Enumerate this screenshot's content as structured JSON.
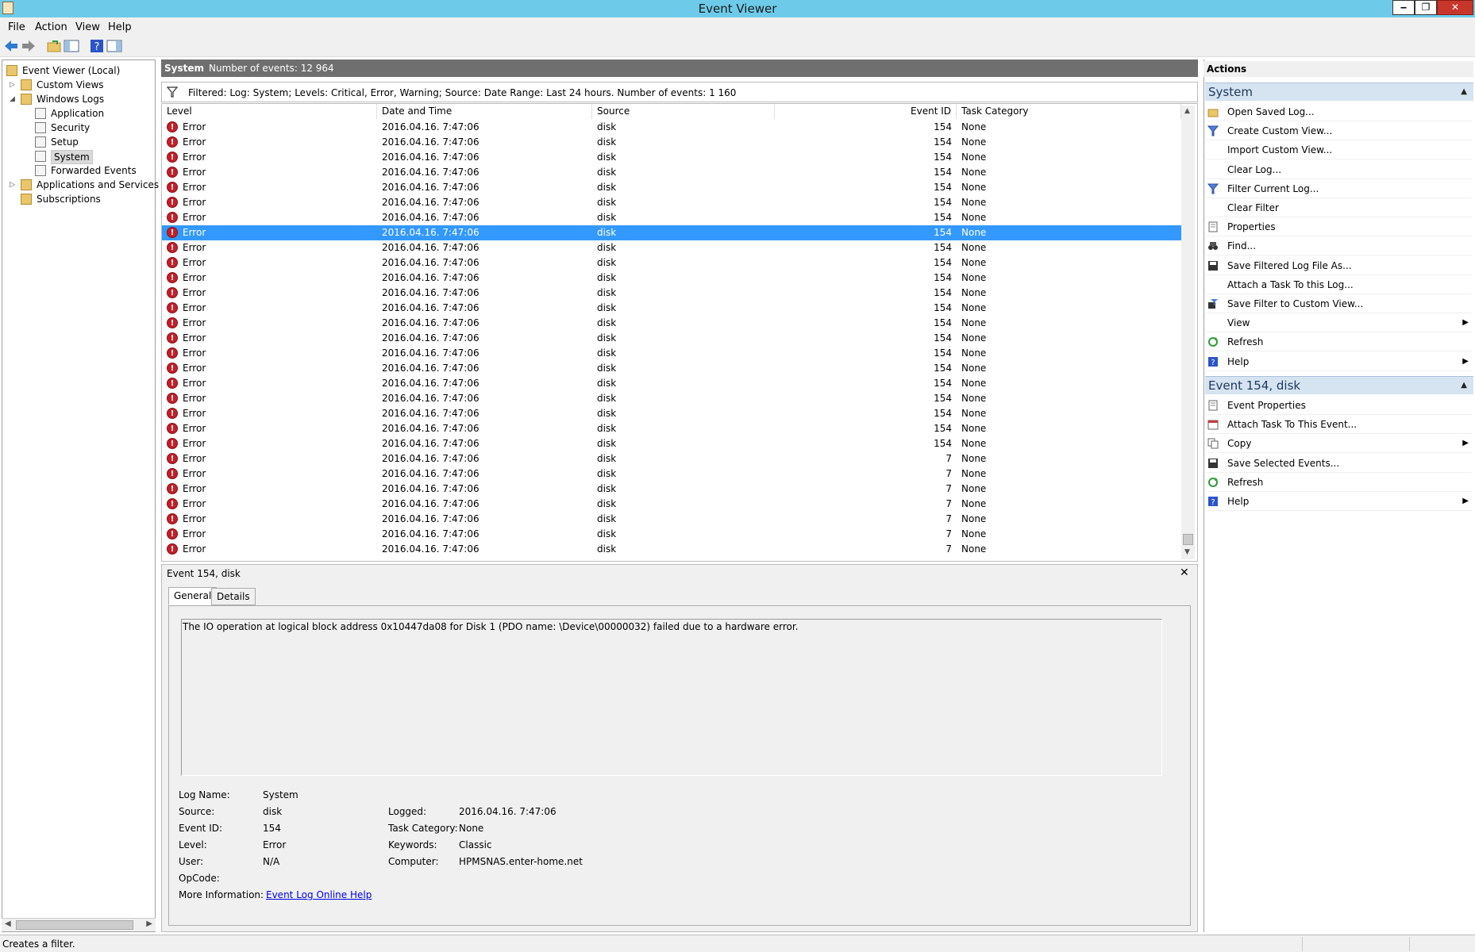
{
  "window": {
    "title": "Event Viewer",
    "min": "‒",
    "max": "❐",
    "close": "✕"
  },
  "menu": [
    "File",
    "Action",
    "View",
    "Help"
  ],
  "tree": [
    {
      "label": "Event Viewer (Local)",
      "indent": 0,
      "expander": ""
    },
    {
      "label": "Custom Views",
      "indent": 1,
      "expander": "▷"
    },
    {
      "label": "Windows Logs",
      "indent": 1,
      "expander": "◢"
    },
    {
      "label": "Application",
      "indent": 2,
      "expander": ""
    },
    {
      "label": "Security",
      "indent": 2,
      "expander": ""
    },
    {
      "label": "Setup",
      "indent": 2,
      "expander": ""
    },
    {
      "label": "System",
      "indent": 2,
      "expander": "",
      "selected": true
    },
    {
      "label": "Forwarded Events",
      "indent": 2,
      "expander": ""
    },
    {
      "label": "Applications and Services Lo",
      "indent": 1,
      "expander": "▷"
    },
    {
      "label": "Subscriptions",
      "indent": 1,
      "expander": ""
    }
  ],
  "center": {
    "log_name": "System",
    "count_text": "Number of events: 12 964",
    "filter_text": "Filtered: Log: System; Levels: Critical, Error, Warning; Source: Date Range: Last 24 hours. Number of events: 1 160",
    "columns": [
      "Level",
      "Date and Time",
      "Source",
      "Event ID",
      "Task Category"
    ],
    "rows": [
      {
        "level": "Error",
        "date": "2016.04.16. 7:47:06",
        "source": "disk",
        "id": "154",
        "task": "None"
      },
      {
        "level": "Error",
        "date": "2016.04.16. 7:47:06",
        "source": "disk",
        "id": "154",
        "task": "None"
      },
      {
        "level": "Error",
        "date": "2016.04.16. 7:47:06",
        "source": "disk",
        "id": "154",
        "task": "None"
      },
      {
        "level": "Error",
        "date": "2016.04.16. 7:47:06",
        "source": "disk",
        "id": "154",
        "task": "None"
      },
      {
        "level": "Error",
        "date": "2016.04.16. 7:47:06",
        "source": "disk",
        "id": "154",
        "task": "None"
      },
      {
        "level": "Error",
        "date": "2016.04.16. 7:47:06",
        "source": "disk",
        "id": "154",
        "task": "None"
      },
      {
        "level": "Error",
        "date": "2016.04.16. 7:47:06",
        "source": "disk",
        "id": "154",
        "task": "None"
      },
      {
        "level": "Error",
        "date": "2016.04.16. 7:47:06",
        "source": "disk",
        "id": "154",
        "task": "None",
        "selected": true
      },
      {
        "level": "Error",
        "date": "2016.04.16. 7:47:06",
        "source": "disk",
        "id": "154",
        "task": "None"
      },
      {
        "level": "Error",
        "date": "2016.04.16. 7:47:06",
        "source": "disk",
        "id": "154",
        "task": "None"
      },
      {
        "level": "Error",
        "date": "2016.04.16. 7:47:06",
        "source": "disk",
        "id": "154",
        "task": "None"
      },
      {
        "level": "Error",
        "date": "2016.04.16. 7:47:06",
        "source": "disk",
        "id": "154",
        "task": "None"
      },
      {
        "level": "Error",
        "date": "2016.04.16. 7:47:06",
        "source": "disk",
        "id": "154",
        "task": "None"
      },
      {
        "level": "Error",
        "date": "2016.04.16. 7:47:06",
        "source": "disk",
        "id": "154",
        "task": "None"
      },
      {
        "level": "Error",
        "date": "2016.04.16. 7:47:06",
        "source": "disk",
        "id": "154",
        "task": "None"
      },
      {
        "level": "Error",
        "date": "2016.04.16. 7:47:06",
        "source": "disk",
        "id": "154",
        "task": "None"
      },
      {
        "level": "Error",
        "date": "2016.04.16. 7:47:06",
        "source": "disk",
        "id": "154",
        "task": "None"
      },
      {
        "level": "Error",
        "date": "2016.04.16. 7:47:06",
        "source": "disk",
        "id": "154",
        "task": "None"
      },
      {
        "level": "Error",
        "date": "2016.04.16. 7:47:06",
        "source": "disk",
        "id": "154",
        "task": "None"
      },
      {
        "level": "Error",
        "date": "2016.04.16. 7:47:06",
        "source": "disk",
        "id": "154",
        "task": "None"
      },
      {
        "level": "Error",
        "date": "2016.04.16. 7:47:06",
        "source": "disk",
        "id": "154",
        "task": "None"
      },
      {
        "level": "Error",
        "date": "2016.04.16. 7:47:06",
        "source": "disk",
        "id": "154",
        "task": "None"
      },
      {
        "level": "Error",
        "date": "2016.04.16. 7:47:06",
        "source": "disk",
        "id": "7",
        "task": "None"
      },
      {
        "level": "Error",
        "date": "2016.04.16. 7:47:06",
        "source": "disk",
        "id": "7",
        "task": "None"
      },
      {
        "level": "Error",
        "date": "2016.04.16. 7:47:06",
        "source": "disk",
        "id": "7",
        "task": "None"
      },
      {
        "level": "Error",
        "date": "2016.04.16. 7:47:06",
        "source": "disk",
        "id": "7",
        "task": "None"
      },
      {
        "level": "Error",
        "date": "2016.04.16. 7:47:06",
        "source": "disk",
        "id": "7",
        "task": "None"
      },
      {
        "level": "Error",
        "date": "2016.04.16. 7:47:06",
        "source": "disk",
        "id": "7",
        "task": "None"
      },
      {
        "level": "Error",
        "date": "2016.04.16. 7:47:06",
        "source": "disk",
        "id": "7",
        "task": "None"
      }
    ]
  },
  "detail": {
    "title": "Event 154, disk",
    "tabs": [
      "General",
      "Details"
    ],
    "message": "The IO operation at logical block address 0x10447da08 for Disk 1 (PDO name: \\Device\\00000032) failed due to a hardware error.",
    "fields_left": [
      {
        "label": "Log Name:",
        "value": "System"
      },
      {
        "label": "Source:",
        "value": "disk"
      },
      {
        "label": "Event ID:",
        "value": "154"
      },
      {
        "label": "Level:",
        "value": "Error"
      },
      {
        "label": "User:",
        "value": "N/A"
      },
      {
        "label": "OpCode:",
        "value": ""
      }
    ],
    "fields_right": [
      {
        "label": "Logged:",
        "value": "2016.04.16. 7:47:06"
      },
      {
        "label": "Task Category:",
        "value": "None"
      },
      {
        "label": "Keywords:",
        "value": "Classic"
      },
      {
        "label": "Computer:",
        "value": "HPMSNAS.enter-home.net"
      }
    ],
    "more_info_label": "More Information:",
    "more_info_link": "Event Log Online Help"
  },
  "actions": {
    "header": "Actions",
    "sections": [
      {
        "title": "System",
        "items": [
          {
            "label": "Open Saved Log...",
            "icon": "folder-open-icon",
            "submenu": false
          },
          {
            "label": "Create Custom View...",
            "icon": "filter-icon",
            "submenu": false
          },
          {
            "label": "Import Custom View...",
            "icon": "",
            "submenu": false
          },
          {
            "label": "Clear Log...",
            "icon": "",
            "submenu": false
          },
          {
            "label": "Filter Current Log...",
            "icon": "filter-icon",
            "submenu": false
          },
          {
            "label": "Clear Filter",
            "icon": "",
            "submenu": false
          },
          {
            "label": "Properties",
            "icon": "properties-icon",
            "submenu": false
          },
          {
            "label": "Find...",
            "icon": "binoculars-icon",
            "submenu": false
          },
          {
            "label": "Save Filtered Log File As...",
            "icon": "save-icon",
            "submenu": false
          },
          {
            "label": "Attach a Task To this Log...",
            "icon": "",
            "submenu": false
          },
          {
            "label": "Save Filter to Custom View...",
            "icon": "save-filter-icon",
            "submenu": false
          },
          {
            "label": "View",
            "icon": "",
            "submenu": true
          },
          {
            "label": "Refresh",
            "icon": "refresh-icon",
            "submenu": false
          },
          {
            "label": "Help",
            "icon": "help-icon",
            "submenu": true
          }
        ]
      },
      {
        "title": "Event 154, disk",
        "items": [
          {
            "label": "Event Properties",
            "icon": "properties-icon",
            "submenu": false
          },
          {
            "label": "Attach Task To This Event...",
            "icon": "task-icon",
            "submenu": false
          },
          {
            "label": "Copy",
            "icon": "copy-icon",
            "submenu": true
          },
          {
            "label": "Save Selected Events...",
            "icon": "save-icon",
            "submenu": false
          },
          {
            "label": "Refresh",
            "icon": "refresh-icon",
            "submenu": false
          },
          {
            "label": "Help",
            "icon": "help-icon",
            "submenu": true
          }
        ]
      }
    ]
  },
  "status": {
    "text": "Creates a filter."
  },
  "colors": {
    "titlebar": "#6dcbe9",
    "selection": "#3399ff",
    "error": "#c0202a",
    "section": "#d6e3f1"
  }
}
